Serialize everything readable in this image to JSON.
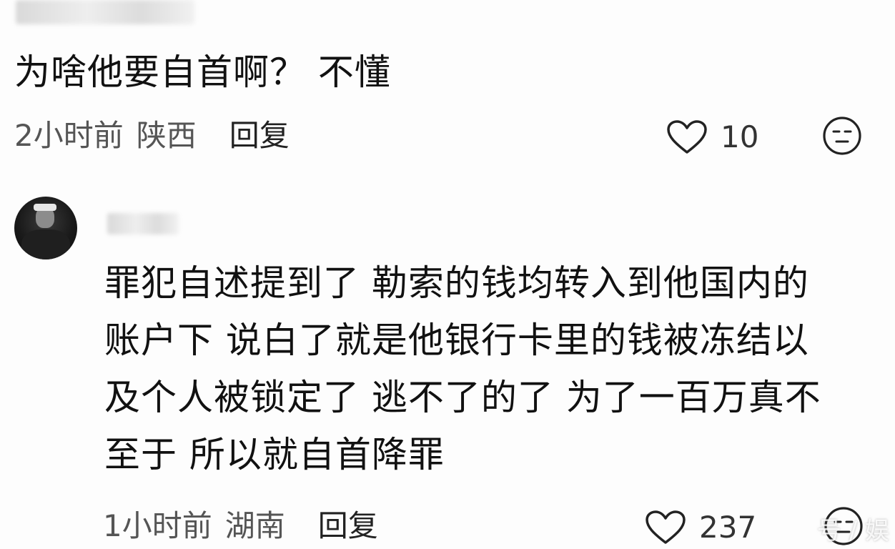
{
  "comments": [
    {
      "text": "为啥他要自首啊？ 不懂",
      "time": "2小时前",
      "location": "陕西",
      "reply_label": "回复",
      "likes": "10"
    },
    {
      "lines": [
        "罪犯自述提到了 勒索的钱均转入到他国内的",
        "账户下 说白了就是他银行卡里的钱被冻结以",
        "及个人被锁定了 逃不了的了 为了一百万真不",
        "至于 所以就自首降罪"
      ],
      "time": "1小时前",
      "location": "湖南",
      "reply_label": "回复",
      "likes": "237"
    }
  ],
  "watermark": "号 / 娱",
  "icons": {
    "like": "heart-outline-icon",
    "dislike": "meh-face-icon"
  },
  "colors": {
    "text": "#111111",
    "meta": "#555555",
    "background": "#fdfdfd"
  }
}
